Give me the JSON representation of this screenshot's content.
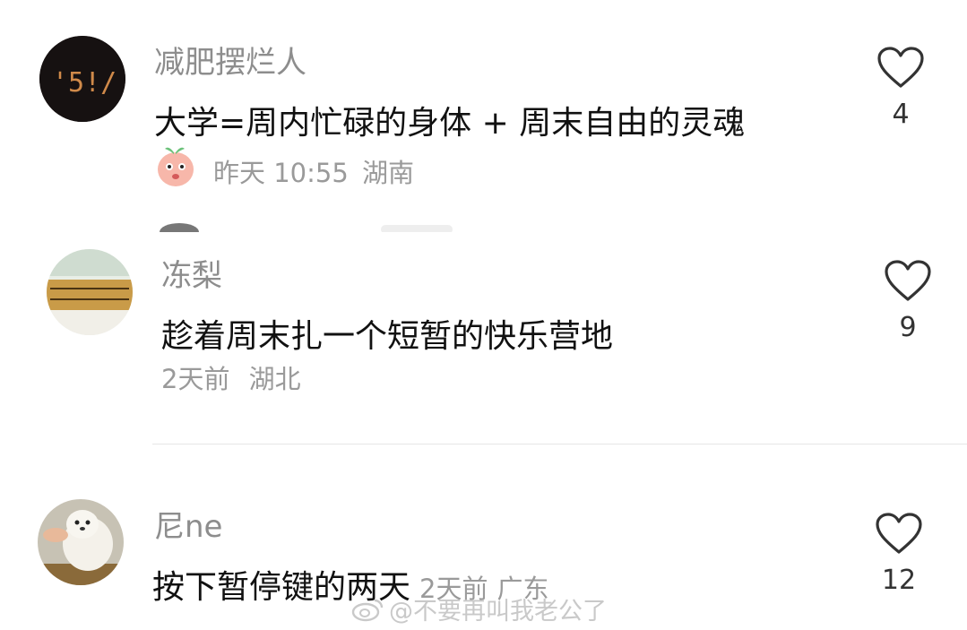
{
  "comments": [
    {
      "username": "减肥摆烂人",
      "content": "大学=周内忙碌的身体 + 周末自由的灵魂",
      "time": "昨天 10:55",
      "location": "湖南",
      "likes": "4",
      "avatar_text": "'5!/"
    },
    {
      "username": "冻梨",
      "content": "趁着周末扎一个短暂的快乐营地",
      "time": "2天前",
      "location": "湖北",
      "likes": "9"
    },
    {
      "username": "尼ne",
      "content": "按下暂停键的两天",
      "time": "2天前",
      "location": "广东",
      "likes": "12"
    }
  ],
  "watermark": "@不要再叫我老公了",
  "colors": {
    "username": "#8d8d8d",
    "meta": "#9a9a9a",
    "divider": "#e6e6e6"
  }
}
